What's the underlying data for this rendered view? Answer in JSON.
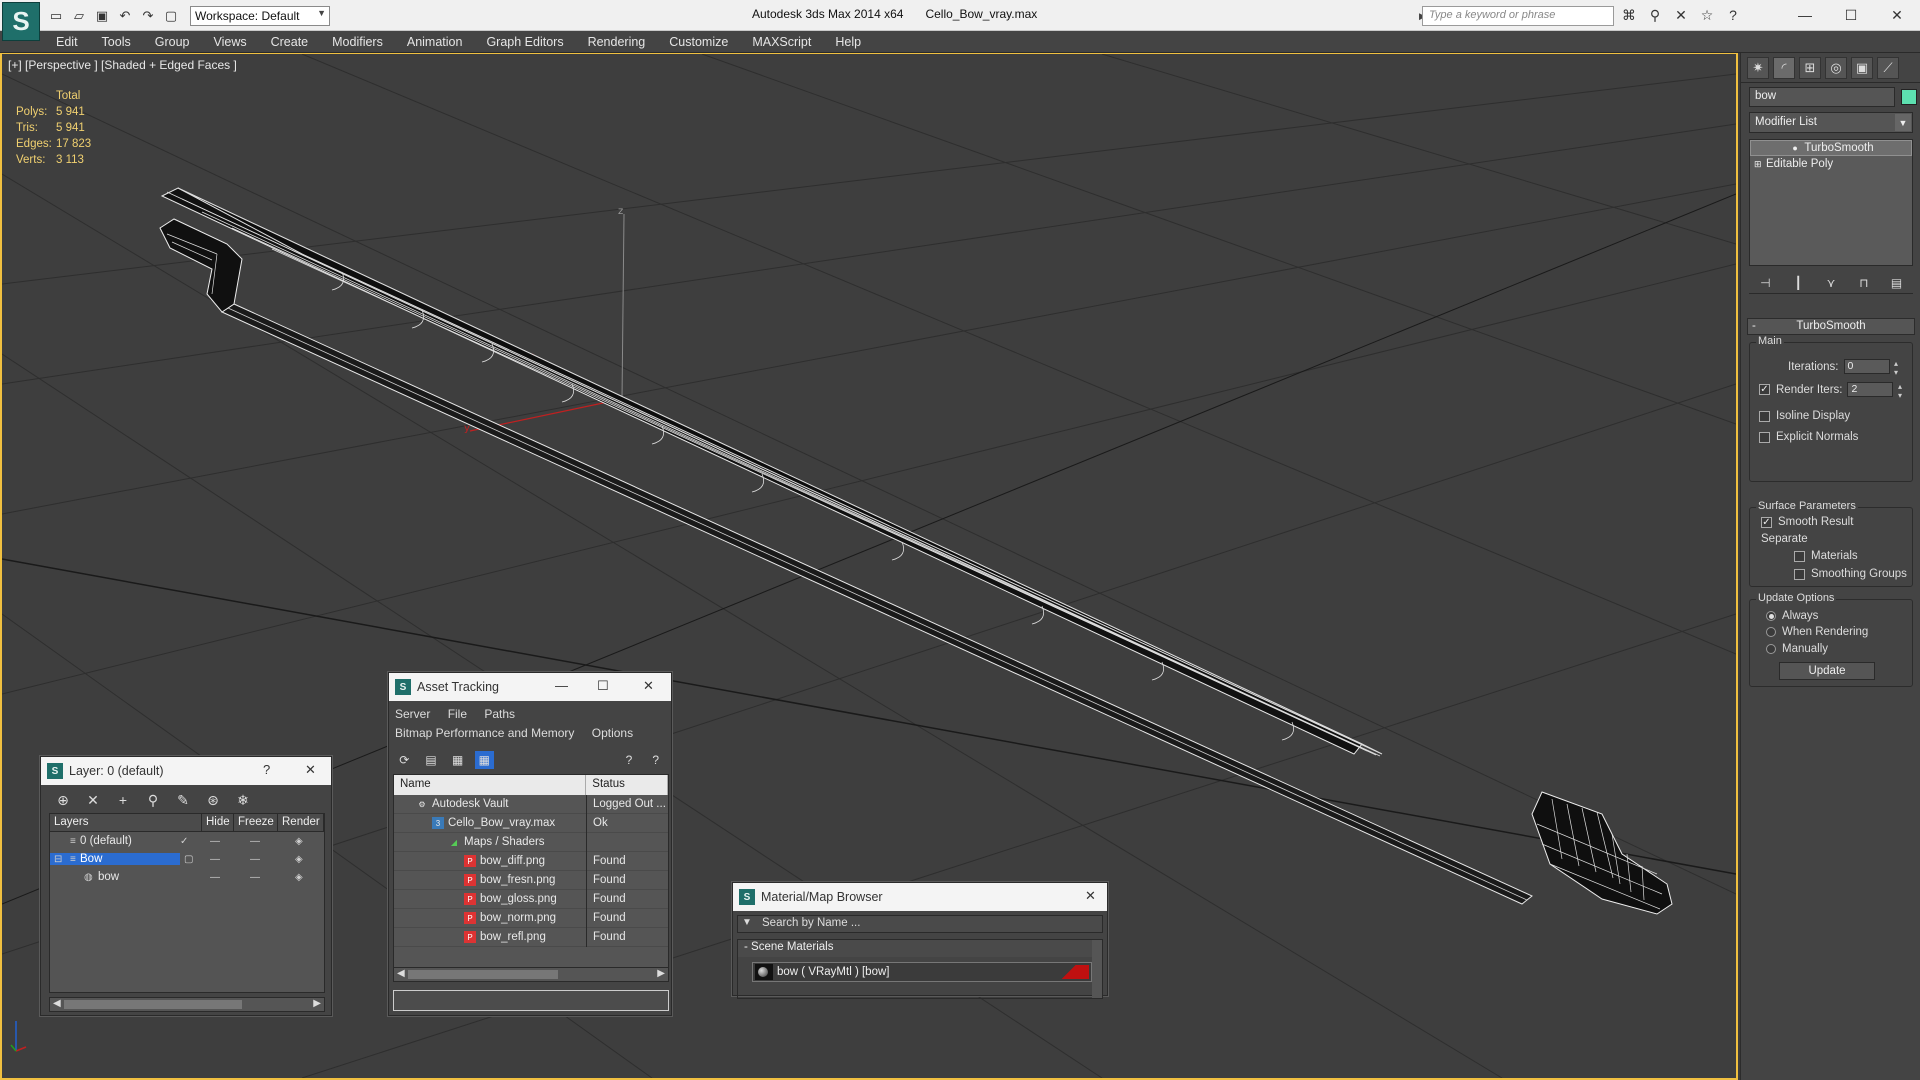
{
  "app": {
    "title": "Autodesk 3ds Max  2014 x64",
    "file": "Cello_Bow_vray.max",
    "workspace": "Workspace: Default",
    "search_placeholder": "Type a keyword or phrase"
  },
  "menu": [
    "Edit",
    "Tools",
    "Group",
    "Views",
    "Create",
    "Modifiers",
    "Animation",
    "Graph Editors",
    "Rendering",
    "Customize",
    "MAXScript",
    "Help"
  ],
  "viewport": {
    "label": "[+] [Perspective ] [Shaded + Edged Faces ]",
    "stats": {
      "header": "Total",
      "rows": [
        {
          "k": "Polys:",
          "v": "5 941"
        },
        {
          "k": "Tris:",
          "v": "5 941"
        },
        {
          "k": "Edges:",
          "v": "17 823"
        },
        {
          "k": "Verts:",
          "v": "3 113"
        }
      ]
    },
    "axes": {
      "x": "x",
      "y": "y",
      "z": "z"
    }
  },
  "command_panel": {
    "object_name": "bow",
    "object_color": "#5de0b0",
    "modifier_list": "Modifier List",
    "stack": [
      "TurboSmooth",
      "Editable Poly"
    ],
    "rollout": "TurboSmooth",
    "main_group": "Main",
    "iterations_label": "Iterations:",
    "iterations_value": "0",
    "render_iters_label": "Render Iters:",
    "render_iters_value": "2",
    "isoline": "Isoline Display",
    "explicit_normals": "Explicit Normals",
    "surface_group": "Surface Parameters",
    "smooth_result": "Smooth Result",
    "separate": "Separate",
    "materials": "Materials",
    "smoothing_groups": "Smoothing Groups",
    "update_group": "Update Options",
    "always": "Always",
    "when_rendering": "When Rendering",
    "manually": "Manually",
    "update_btn": "Update"
  },
  "layer_dialog": {
    "title": "Layer: 0 (default)",
    "help": "?",
    "columns": [
      "Layers",
      "Hide",
      "Freeze",
      "Render"
    ],
    "rows": [
      {
        "name": "0 (default)"
      },
      {
        "name": "Bow"
      },
      {
        "name": "bow"
      }
    ]
  },
  "asset_dialog": {
    "title": "Asset Tracking",
    "menu1": [
      "Server",
      "File",
      "Paths"
    ],
    "menu2": [
      "Bitmap Performance and Memory",
      "Options"
    ],
    "columns": [
      "Name",
      "Status"
    ],
    "rows": [
      {
        "name": "Autodesk Vault",
        "status": "Logged Out ..."
      },
      {
        "name": "Cello_Bow_vray.max",
        "status": "Ok"
      },
      {
        "name": "Maps / Shaders",
        "status": ""
      },
      {
        "name": "bow_diff.png",
        "status": "Found"
      },
      {
        "name": "bow_fresn.png",
        "status": "Found"
      },
      {
        "name": "bow_gloss.png",
        "status": "Found"
      },
      {
        "name": "bow_norm.png",
        "status": "Found"
      },
      {
        "name": "bow_refl.png",
        "status": "Found"
      }
    ]
  },
  "material_dialog": {
    "title": "Material/Map Browser",
    "search": "Search by Name ...",
    "group": "- Scene Materials",
    "item": "bow  ( VRayMtl )  [bow]"
  },
  "colors": {
    "viewport_border": "#f0c040",
    "stats_text": "#f0d070",
    "selection": "#2b6cd0"
  }
}
